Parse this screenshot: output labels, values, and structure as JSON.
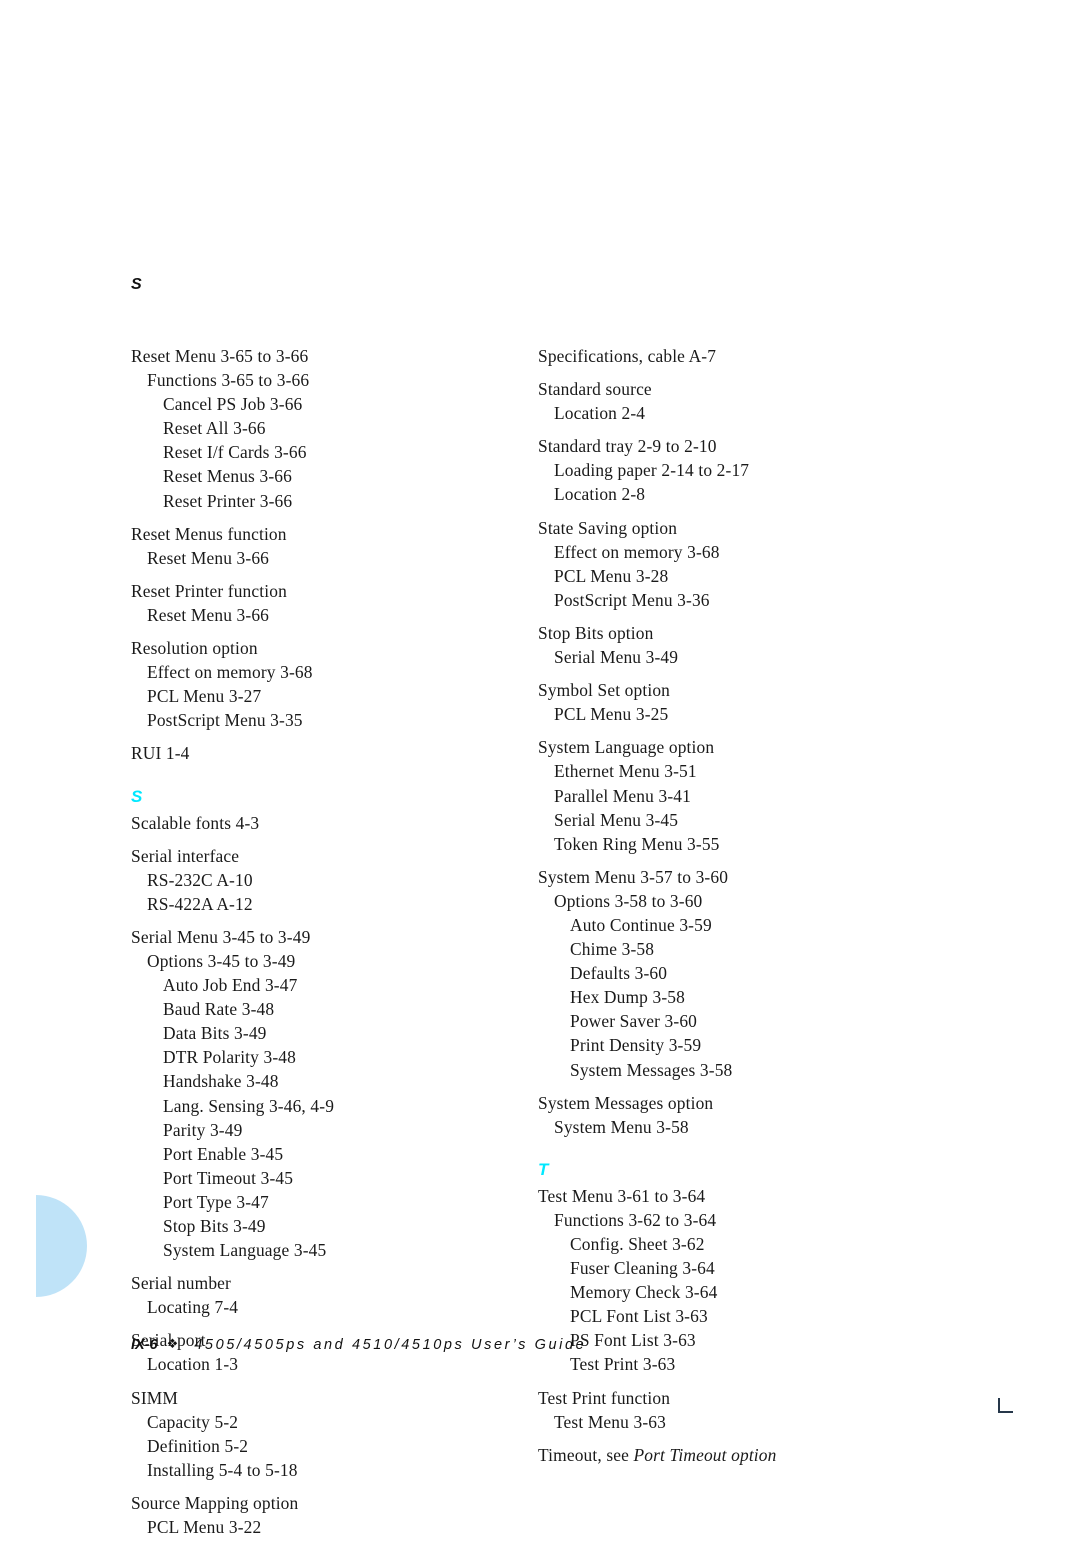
{
  "running_head": "S",
  "footer": {
    "folio": "IX-6",
    "diamond": "❖",
    "title": "4505/4505ps and 4510/4510ps User’s Guide"
  },
  "colors": {
    "section_letter": "#00e8ff",
    "decoration": "#bfe3f8",
    "crop_mark": "#26374a",
    "text": "#1a1a1a"
  },
  "columns": {
    "left": {
      "blocks": [
        {
          "type": "group",
          "entries": [
            {
              "level": 0,
              "text": "Reset Menu 3-65 to 3-66"
            },
            {
              "level": 1,
              "text": "Functions 3-65 to 3-66"
            },
            {
              "level": 2,
              "text": "Cancel PS Job 3-66"
            },
            {
              "level": 2,
              "text": "Reset All 3-66"
            },
            {
              "level": 2,
              "text": "Reset I/f Cards 3-66"
            },
            {
              "level": 2,
              "text": "Reset Menus 3-66"
            },
            {
              "level": 2,
              "text": "Reset Printer 3-66"
            }
          ]
        },
        {
          "type": "group",
          "entries": [
            {
              "level": 0,
              "text": "Reset Menus function"
            },
            {
              "level": 1,
              "text": "Reset Menu 3-66"
            }
          ]
        },
        {
          "type": "group",
          "entries": [
            {
              "level": 0,
              "text": "Reset Printer function"
            },
            {
              "level": 1,
              "text": "Reset Menu 3-66"
            }
          ]
        },
        {
          "type": "group",
          "entries": [
            {
              "level": 0,
              "text": "Resolution option"
            },
            {
              "level": 1,
              "text": "Effect on memory 3-68"
            },
            {
              "level": 1,
              "text": "PCL Menu 3-27"
            },
            {
              "level": 1,
              "text": "PostScript Menu 3-35"
            }
          ]
        },
        {
          "type": "group",
          "entries": [
            {
              "level": 0,
              "text": "RUI 1-4"
            }
          ]
        },
        {
          "type": "letter",
          "text": "S"
        },
        {
          "type": "group",
          "entries": [
            {
              "level": 0,
              "text": "Scalable fonts 4-3"
            }
          ]
        },
        {
          "type": "group",
          "entries": [
            {
              "level": 0,
              "text": "Serial interface"
            },
            {
              "level": 1,
              "text": "RS-232C A-10"
            },
            {
              "level": 1,
              "text": "RS-422A A-12"
            }
          ]
        },
        {
          "type": "group",
          "entries": [
            {
              "level": 0,
              "text": "Serial Menu 3-45 to 3-49"
            },
            {
              "level": 1,
              "text": "Options 3-45 to 3-49"
            },
            {
              "level": 2,
              "text": "Auto Job End 3-47"
            },
            {
              "level": 2,
              "text": "Baud Rate 3-48"
            },
            {
              "level": 2,
              "text": "Data Bits 3-49"
            },
            {
              "level": 2,
              "text": "DTR Polarity 3-48"
            },
            {
              "level": 2,
              "text": "Handshake 3-48"
            },
            {
              "level": 2,
              "text": "Lang. Sensing 3-46, 4-9"
            },
            {
              "level": 2,
              "text": "Parity 3-49"
            },
            {
              "level": 2,
              "text": "Port Enable 3-45"
            },
            {
              "level": 2,
              "text": "Port Timeout 3-45"
            },
            {
              "level": 2,
              "text": "Port Type 3-47"
            },
            {
              "level": 2,
              "text": "Stop Bits 3-49"
            },
            {
              "level": 2,
              "text": "System Language 3-45"
            }
          ]
        },
        {
          "type": "group",
          "entries": [
            {
              "level": 0,
              "text": "Serial number"
            },
            {
              "level": 1,
              "text": "Locating 7-4"
            }
          ]
        },
        {
          "type": "group",
          "entries": [
            {
              "level": 0,
              "text": "Serial port"
            },
            {
              "level": 1,
              "text": "Location 1-3"
            }
          ]
        },
        {
          "type": "group",
          "entries": [
            {
              "level": 0,
              "text": "SIMM"
            },
            {
              "level": 1,
              "text": "Capacity 5-2"
            },
            {
              "level": 1,
              "text": "Definition 5-2"
            },
            {
              "level": 1,
              "text": "Installing 5-4 to 5-18"
            }
          ]
        },
        {
          "type": "group",
          "entries": [
            {
              "level": 0,
              "text": "Source Mapping option"
            },
            {
              "level": 1,
              "text": "PCL Menu 3-22"
            }
          ]
        }
      ]
    },
    "right": {
      "blocks": [
        {
          "type": "group",
          "entries": [
            {
              "level": 0,
              "text": "Specifications, cable A-7"
            }
          ]
        },
        {
          "type": "group",
          "entries": [
            {
              "level": 0,
              "text": "Standard source"
            },
            {
              "level": 1,
              "text": "Location 2-4"
            }
          ]
        },
        {
          "type": "group",
          "entries": [
            {
              "level": 0,
              "text": "Standard tray 2-9 to 2-10"
            },
            {
              "level": 1,
              "text": "Loading paper 2-14 to 2-17"
            },
            {
              "level": 1,
              "text": "Location 2-8"
            }
          ]
        },
        {
          "type": "group",
          "entries": [
            {
              "level": 0,
              "text": "State Saving option"
            },
            {
              "level": 1,
              "text": "Effect on memory 3-68"
            },
            {
              "level": 1,
              "text": "PCL Menu 3-28"
            },
            {
              "level": 1,
              "text": "PostScript Menu 3-36"
            }
          ]
        },
        {
          "type": "group",
          "entries": [
            {
              "level": 0,
              "text": "Stop Bits option"
            },
            {
              "level": 1,
              "text": "Serial Menu 3-49"
            }
          ]
        },
        {
          "type": "group",
          "entries": [
            {
              "level": 0,
              "text": "Symbol Set option"
            },
            {
              "level": 1,
              "text": "PCL Menu 3-25"
            }
          ]
        },
        {
          "type": "group",
          "entries": [
            {
              "level": 0,
              "text": "System Language option"
            },
            {
              "level": 1,
              "text": "Ethernet Menu 3-51"
            },
            {
              "level": 1,
              "text": "Parallel Menu 3-41"
            },
            {
              "level": 1,
              "text": "Serial Menu 3-45"
            },
            {
              "level": 1,
              "text": "Token Ring Menu 3-55"
            }
          ]
        },
        {
          "type": "group",
          "entries": [
            {
              "level": 0,
              "text": "System Menu 3-57 to 3-60"
            },
            {
              "level": 1,
              "text": "Options 3-58 to 3-60"
            },
            {
              "level": 2,
              "text": "Auto Continue 3-59"
            },
            {
              "level": 2,
              "text": "Chime 3-58"
            },
            {
              "level": 2,
              "text": "Defaults 3-60"
            },
            {
              "level": 2,
              "text": "Hex Dump 3-58"
            },
            {
              "level": 2,
              "text": "Power Saver 3-60"
            },
            {
              "level": 2,
              "text": "Print Density 3-59"
            },
            {
              "level": 2,
              "text": "System Messages 3-58"
            }
          ]
        },
        {
          "type": "group",
          "entries": [
            {
              "level": 0,
              "text": "System Messages option"
            },
            {
              "level": 1,
              "text": "System Menu 3-58"
            }
          ]
        },
        {
          "type": "letter",
          "text": "T"
        },
        {
          "type": "group",
          "entries": [
            {
              "level": 0,
              "text": "Test Menu 3-61 to 3-64"
            },
            {
              "level": 1,
              "text": "Functions 3-62 to 3-64"
            },
            {
              "level": 2,
              "text": "Config. Sheet 3-62"
            },
            {
              "level": 2,
              "text": "Fuser Cleaning 3-64"
            },
            {
              "level": 2,
              "text": "Memory Check 3-64"
            },
            {
              "level": 2,
              "text": "PCL Font List 3-63"
            },
            {
              "level": 2,
              "text": "PS Font List 3-63"
            },
            {
              "level": 2,
              "text": "Test Print 3-63"
            }
          ]
        },
        {
          "type": "group",
          "entries": [
            {
              "level": 0,
              "text": "Test Print function"
            },
            {
              "level": 1,
              "text": "Test Menu 3-63"
            }
          ]
        },
        {
          "type": "group",
          "entries": [
            {
              "level": 0,
              "text": "Timeout, see ",
              "italic_suffix": "Port Timeout option"
            }
          ]
        }
      ]
    }
  }
}
